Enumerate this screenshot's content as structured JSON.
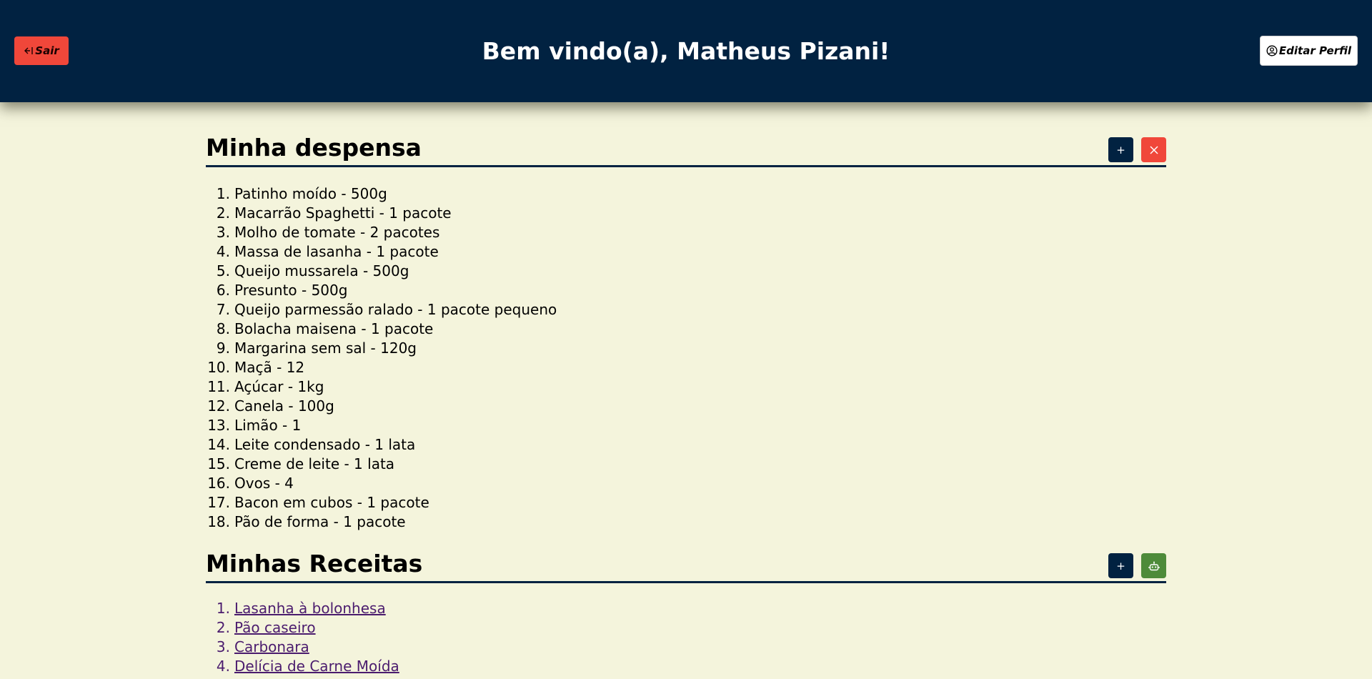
{
  "header": {
    "title": "Bem vindo(a), Matheus Pizani!",
    "logout_label": "Sair",
    "logout_icon": "logout-arrow-icon",
    "edit_profile_label": "Editar Perfil",
    "edit_profile_icon": "user-circle-icon",
    "background": "#012241",
    "logout_color": "#f0473a"
  },
  "pantry": {
    "title": "Minha despensa",
    "add_label": "+",
    "delete_icon": "close-icon",
    "items": [
      {
        "num": "1.",
        "text": "Patinho moído - 500g"
      },
      {
        "num": "2.",
        "text": "Macarrão Spaghetti - 1 pacote"
      },
      {
        "num": "3.",
        "text": "Molho de tomate - 2 pacotes"
      },
      {
        "num": "4.",
        "text": "Massa de lasanha - 1 pacote"
      },
      {
        "num": "5.",
        "text": "Queijo mussarela - 500g"
      },
      {
        "num": "6.",
        "text": "Presunto - 500g"
      },
      {
        "num": "7.",
        "text": "Queijo parmessão ralado - 1 pacote pequeno"
      },
      {
        "num": "8.",
        "text": "Bolacha maisena - 1 pacote"
      },
      {
        "num": "9.",
        "text": "Margarina sem sal - 120g"
      },
      {
        "num": "10.",
        "text": "Maçã - 12"
      },
      {
        "num": "11.",
        "text": "Açúcar - 1kg"
      },
      {
        "num": "12.",
        "text": "Canela - 100g"
      },
      {
        "num": "13.",
        "text": "Limão - 1"
      },
      {
        "num": "14.",
        "text": "Leite condensado - 1 lata"
      },
      {
        "num": "15.",
        "text": "Creme de leite - 1 lata"
      },
      {
        "num": "16.",
        "text": "Ovos - 4"
      },
      {
        "num": "17.",
        "text": "Bacon em cubos - 1 pacote"
      },
      {
        "num": "18.",
        "text": "Pão de forma - 1 pacote"
      }
    ]
  },
  "recipes": {
    "title": "Minhas Receitas",
    "add_label": "+",
    "assistant_icon": "robot-icon",
    "items": [
      {
        "num": "1.",
        "text": "Lasanha à bolonhesa"
      },
      {
        "num": "2.",
        "text": "Pão caseiro"
      },
      {
        "num": "3.",
        "text": "Carbonara"
      },
      {
        "num": "4.",
        "text": "Delícia de Carne Moída"
      }
    ]
  },
  "colors": {
    "page_background": "#f4f4dc",
    "primary": "#012241",
    "danger": "#f0473a",
    "success": "#4e8b3a",
    "link_visited": "#4b1c6e"
  }
}
